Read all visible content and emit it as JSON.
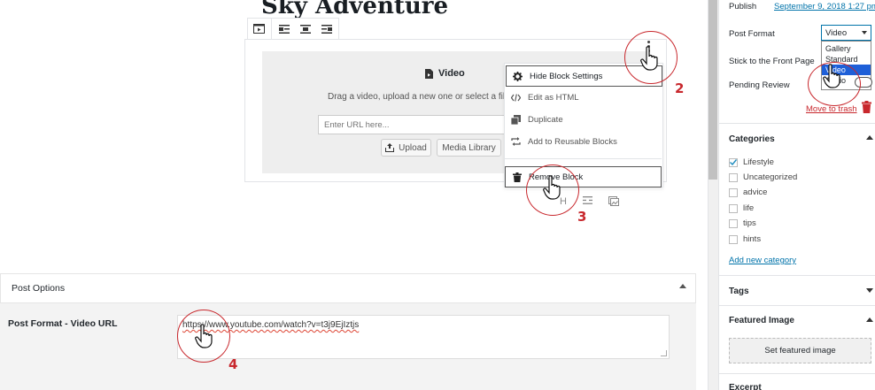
{
  "editor": {
    "post_title": "Sky Adventure",
    "block_placeholder": {
      "title": "Video",
      "instructions": "Drag a video, upload a new one or select a file fro",
      "url_placeholder": "Enter URL here...",
      "upload_label": "Upload",
      "media_library_label": "Media Library"
    },
    "toolbar_icons": [
      "video-block-icon",
      "align-left-icon",
      "align-center-icon",
      "align-right-icon"
    ],
    "block_menu": {
      "items": [
        {
          "label": "Hide Block Settings",
          "icon": "gear-icon"
        },
        {
          "label": "Edit as HTML",
          "icon": "html-icon"
        },
        {
          "label": "Duplicate",
          "icon": "duplicate-icon"
        },
        {
          "label": "Add to Reusable Blocks",
          "icon": "reusable-icon"
        },
        {
          "label": "Remove Block",
          "icon": "trash-icon"
        }
      ]
    },
    "inserter_heading_glyph": "H"
  },
  "annotations": {
    "step2": "2",
    "step3": "3",
    "step4": "4",
    "color": "#c8282d"
  },
  "post_options": {
    "title": "Post Options",
    "field_label": "Post Format - Video URL",
    "field_value": "https://www.youtube.com/watch?v=t3j9EjIztjs"
  },
  "sidebar": {
    "publish_label": "Publish",
    "publish_date": "September 9, 2018 1:27 pm",
    "post_format_label": "Post Format",
    "post_format_value": "Video",
    "post_format_options": [
      "Gallery",
      "Standard",
      "Video",
      "Audio"
    ],
    "post_format_selected_index": 2,
    "sticky_label": "Stick to the Front Page",
    "pending_label": "Pending Review",
    "trash_label": "Move to trash",
    "categories_title": "Categories",
    "categories": [
      {
        "label": "Lifestyle",
        "checked": true
      },
      {
        "label": "Uncategorized",
        "checked": false
      },
      {
        "label": "advice",
        "checked": false
      },
      {
        "label": "life",
        "checked": false
      },
      {
        "label": "tips",
        "checked": false
      },
      {
        "label": "hints",
        "checked": false
      }
    ],
    "add_category_label": "Add new category",
    "tags_title": "Tags",
    "featured_title": "Featured Image",
    "set_featured_label": "Set featured image",
    "excerpt_title": "Excerpt"
  },
  "colors": {
    "link": "#0073aa",
    "select_highlight": "#1e5fd8",
    "annotation": "#c8282d"
  }
}
